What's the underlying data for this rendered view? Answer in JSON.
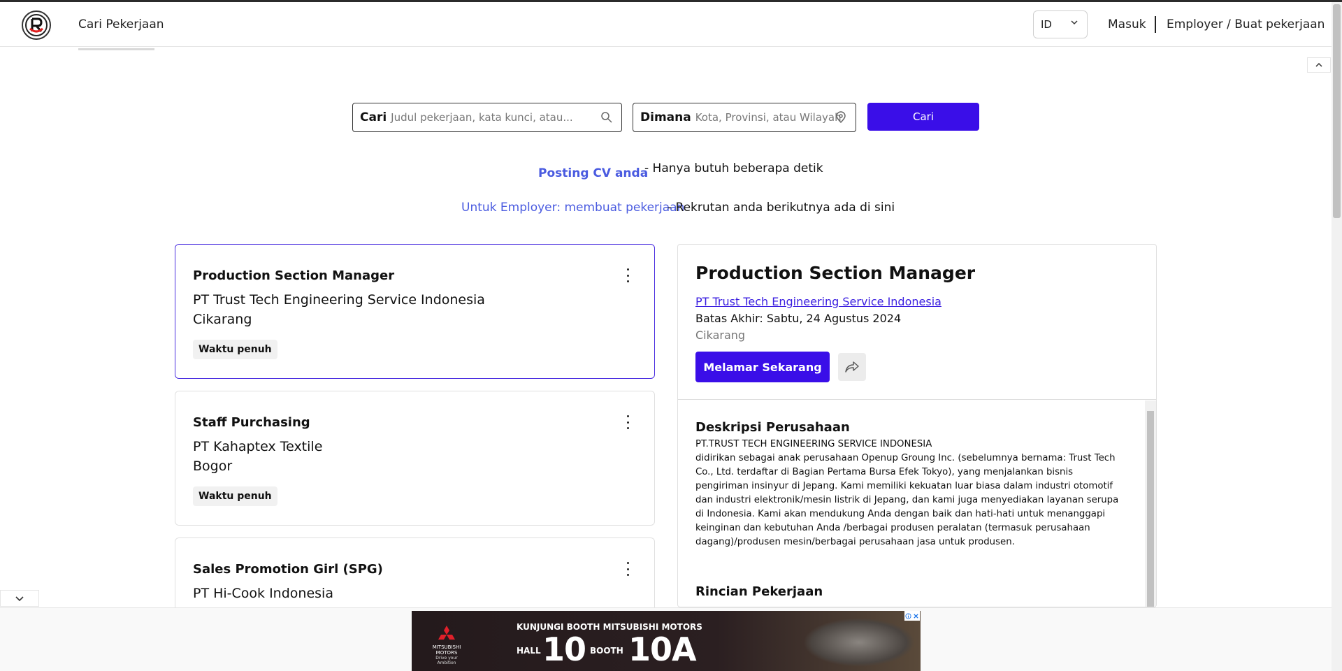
{
  "header": {
    "nav_title": "Cari Pekerjaan",
    "language": "ID",
    "login": "Masuk",
    "employer_link": "Employer / Buat pekerjaan"
  },
  "search": {
    "what_label": "Cari",
    "what_placeholder": "Judul pekerjaan, kata kunci, atau...",
    "where_label": "Dimana",
    "where_placeholder": "Kota, Provinsi, atau Wilayah",
    "button": "Cari"
  },
  "promo": {
    "post_cv": "Posting CV anda",
    "post_cv_desc": "-  Hanya butuh beberapa detik",
    "employer": "Untuk Employer: membuat pekerjaan",
    "employer_desc": "-  Rekrutan anda berikutnya ada di sini"
  },
  "jobs": [
    {
      "title": "Production Section Manager",
      "company": "PT Trust Tech Engineering Service Indonesia",
      "location": "Cikarang",
      "type": "Waktu penuh"
    },
    {
      "title": "Staff Purchasing",
      "company": "PT Kahaptex Textile",
      "location": "Bogor",
      "type": "Waktu penuh"
    },
    {
      "title": "Sales Promotion Girl (SPG)",
      "company": "PT Hi-Cook Indonesia",
      "location": "",
      "type": ""
    }
  ],
  "detail": {
    "title": "Production Section Manager",
    "company": "PT Trust Tech Engineering Service Indonesia",
    "deadline": "Batas Akhir: Sabtu, 24 Agustus 2024",
    "location": "Cikarang",
    "apply": "Melamar Sekarang",
    "company_desc_title": "Deskripsi Perusahaan",
    "company_desc_line1": "PT.TRUST TECH ENGINEERING SERVICE INDONESIA",
    "company_desc_body": "didirikan sebagai anak perusahaan Openup Groung Inc. (sebelumnya bernama: Trust Tech Co., Ltd. terdaftar di Bagian Pertama Bursa Efek Tokyo), yang menjalankan bisnis pengiriman insinyur di Jepang. Kami memiliki kekuatan luar biasa dalam industri otomotif dan industri elektronik/mesin listrik di Jepang, dan kami juga menyediakan layanan serupa di Indonesia. Kami akan mendukung Anda dengan baik dan hati-hati untuk menanggapi keinginan dan kebutuhan Anda /berbagai produsen peralatan (termasuk perusahaan dagang)/produsen mesin/berbagai perusahaan jasa untuk produsen.",
    "job_detail_title": "Rincian Pekerjaan"
  },
  "ad": {
    "brand": "MITSUBISHI MOTORS",
    "tagline": "Drive your Ambition",
    "headline": "KUNJUNGI BOOTH MITSUBISHI MOTORS",
    "hall_label": "HALL",
    "hall_number": "10",
    "booth_label": "BOOTH",
    "booth_number": "10A"
  }
}
